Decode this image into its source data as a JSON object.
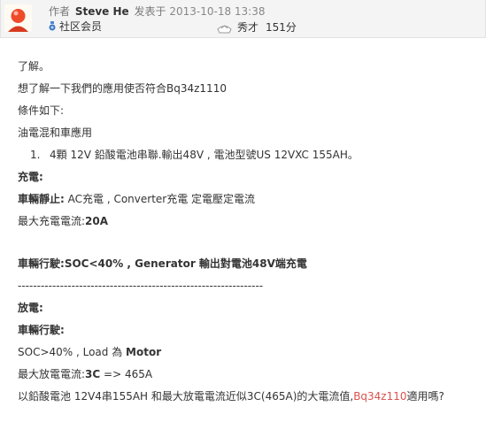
{
  "post": {
    "author_prefix": "作者",
    "author_name": "Steve He",
    "posted_prefix": "发表于",
    "posted_time": "2013-10-18 13:38",
    "role": "社区会员",
    "rank": "秀才",
    "points": "151分"
  },
  "content": {
    "line1": "了解。",
    "line2": "想了解一下我們的應用使否符合Bq34z1110",
    "line3": "條件如下:",
    "line4": "油電混和車應用",
    "list_num": "1.",
    "list_item": "4顆 12V 鉛酸電池串聯.輸出48V , 電池型號US 12VXC 155AH。",
    "charge_title": "充電:",
    "static_label": "車輛靜止:",
    "static_text": " AC充電 , Converter充電 定電壓定電流",
    "max_charge_label": "最大充電電流:",
    "max_charge_value": "20A",
    "driving_label": "車輛行駛:",
    "driving_text": "SOC<40% , Generator 輸出對電池48V端充電",
    "divider": "----------------------------------------------------------------",
    "discharge_title": "放電:",
    "driving2_label": "車輛行駛:",
    "soc_text": "SOC>40% , Load 為 ",
    "soc_motor": "Motor",
    "max_discharge_label": "最大放電電流:",
    "max_discharge_bold": "3C",
    "max_discharge_rest": " => 465A",
    "question_pre": "以鉛酸電池 12V4串155AH 和最大放電電流近似3C(465A)的大電流值,",
    "question_chip": "Bq34z110",
    "question_post": "適用嗎?"
  },
  "colors": {
    "header_bg": "#f4f4f4",
    "highlight": "#d9534f"
  }
}
